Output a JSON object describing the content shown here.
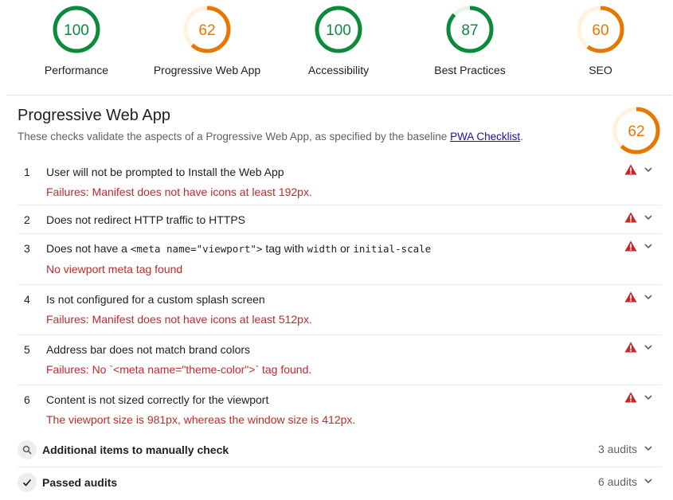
{
  "colors": {
    "pass": "#0c8a3c",
    "pass_track": "#e6f4ea",
    "average": "#e67700",
    "average_track": "#fff3e0",
    "fail": "#c62828",
    "link": "#1a0dab"
  },
  "gauges": [
    {
      "score": 100,
      "label": "Performance",
      "status": "pass"
    },
    {
      "score": 62,
      "label": "Progressive Web App",
      "status": "average"
    },
    {
      "score": 100,
      "label": "Accessibility",
      "status": "pass"
    },
    {
      "score": 87,
      "label": "Best Practices",
      "status": "pass"
    },
    {
      "score": 60,
      "label": "SEO",
      "status": "average"
    }
  ],
  "category": {
    "title": "Progressive Web App",
    "description": "These checks validate the aspects of a Progressive Web App, as specified by the baseline ",
    "link_text": "PWA Checklist",
    "description_end": ".",
    "score": 62
  },
  "audits": [
    {
      "num": "1",
      "title": "User will not be prompted to Install the Web App",
      "failure": "Failures: Manifest does not have icons at least 192px.",
      "icon": "warning-icon"
    },
    {
      "num": "2",
      "title": "Does not redirect HTTP traffic to HTTPS",
      "failure": "",
      "icon": "warning-icon"
    },
    {
      "num": "3",
      "title_parts": [
        "Does not have a ",
        "<meta name=\"viewport\">",
        " tag with ",
        "width",
        " or ",
        "initial-scale"
      ],
      "failure": "No viewport meta tag found",
      "icon": "warning-icon"
    },
    {
      "num": "4",
      "title": "Is not configured for a custom splash screen",
      "failure": "Failures: Manifest does not have icons at least 512px.",
      "icon": "warning-icon"
    },
    {
      "num": "5",
      "title": "Address bar does not match brand colors",
      "failure": "Failures: No `<meta name=\"theme-color\">` tag found.",
      "icon": "warning-icon"
    },
    {
      "num": "6",
      "title": "Content is not sized correctly for the viewport",
      "failure": "The viewport size is 981px, whereas the window size is 412px.",
      "icon": "warning-icon"
    }
  ],
  "groups": [
    {
      "title": "Additional items to manually check",
      "count": "3 audits",
      "icon": "search-icon"
    },
    {
      "title": "Passed audits",
      "count": "6 audits",
      "icon": "check-icon"
    }
  ]
}
